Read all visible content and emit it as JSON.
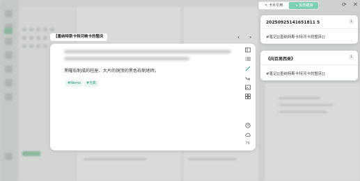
{
  "card": {
    "title_tag": "[[]]墨纳特斯卡特河峡中的木卡管的整床",
    "title_tag_display": "【墨纳特斯卡特河峡卡的整床",
    "body_text": "黑曜石制成的柱座、大片的铜顶的黑色石制地砖。",
    "tags": [
      "#Nemo",
      "#光影"
    ],
    "word_count": "79"
  },
  "refs_panel": {
    "tabs": [
      "卡片引用",
      "反向链接"
    ],
    "refs": [
      {
        "title": "20250925141651811 5",
        "count": "1",
        "line": "#笔记[[墨纳特斯卡特河卡的整床]]"
      },
      {
        "title": "《向百男西来》",
        "count": "1",
        "line": "#笔记[[墨纳特斯卡特河卡的整床]]"
      }
    ]
  },
  "colors": {
    "accent": "#7fcfb7",
    "tag_text": "#2f9a7e"
  },
  "icons": [
    "sidebar-toggle-icon",
    "list-icon",
    "brush-icon",
    "redo-icon",
    "image-icon",
    "grid-icon",
    "history-icon",
    "cloud-icon",
    "refresh-icon",
    "close-icon",
    "chevron-left-icon",
    "chevron-right-icon"
  ]
}
